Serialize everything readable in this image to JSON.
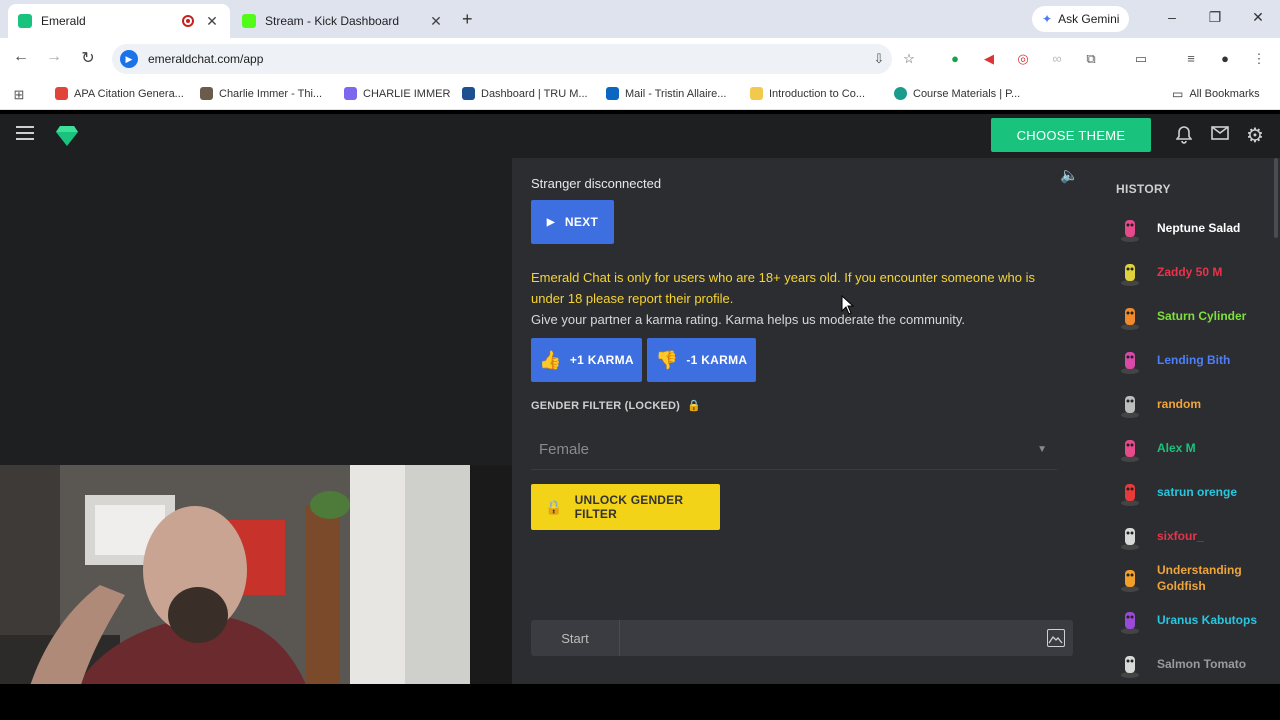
{
  "browser": {
    "tabs": [
      {
        "title": "Emerald",
        "active": true,
        "favicon_color": "#19c37d"
      },
      {
        "title": "Stream - Kick Dashboard",
        "active": false,
        "favicon_color": "#53fc18"
      }
    ],
    "ask_gemini": "Ask Gemini",
    "url": "emeraldchat.com/app",
    "bookmarks": [
      {
        "label": "APA Citation Genera...",
        "color": "#e0453a"
      },
      {
        "label": "Charlie Immer - Thi...",
        "color": "#6b5b4b"
      },
      {
        "label": "CHARLIE IMMER",
        "color": "#7b68ee"
      },
      {
        "label": "Dashboard | TRU M...",
        "color": "#1d4f91"
      },
      {
        "label": "Mail - Tristin Allaire...",
        "color": "#0a66c2"
      },
      {
        "label": "Introduction to Co...",
        "color": "#f2c94c"
      },
      {
        "label": "Course Materials | P...",
        "color": "#1a9c8c"
      }
    ],
    "all_bookmarks": "All Bookmarks"
  },
  "app": {
    "choose_theme": "CHOOSE THEME",
    "status": "Stranger disconnected",
    "next_label": "NEXT",
    "notice": "Emerald Chat is only for users who are 18+ years old. If you encounter someone who is under 18 please report their profile.",
    "karma_text": "Give your partner a karma rating. Karma helps us moderate the community.",
    "plus_karma": "+1 KARMA",
    "minus_karma": "-1 KARMA",
    "gender_filter_label": "GENDER FILTER (LOCKED)",
    "gender_filter_value": "Female",
    "unlock_label": "UNLOCK GENDER FILTER",
    "start_label": "Start",
    "accent_color": "#19c37d"
  },
  "history": {
    "title": "HISTORY",
    "items": [
      {
        "name": "Neptune Salad",
        "color": "#ffffff"
      },
      {
        "name": "Zaddy 50 M",
        "color": "#e8334a"
      },
      {
        "name": "Saturn Cylinder",
        "color": "#7fe03a"
      },
      {
        "name": "Lending Bith",
        "color": "#4f7ef7"
      },
      {
        "name": "random",
        "color": "#f0a53a"
      },
      {
        "name": "Alex M",
        "color": "#19c37d"
      },
      {
        "name": "satrun orenge",
        "color": "#27c7e0"
      },
      {
        "name": "sixfour_",
        "color": "#e8334a"
      },
      {
        "name": "Understanding Goldfish",
        "color": "#f0a53a"
      },
      {
        "name": "Uranus Kabutops",
        "color": "#27c7e0"
      },
      {
        "name": "Salmon Tomato",
        "color": "#9a9a9a"
      }
    ]
  }
}
